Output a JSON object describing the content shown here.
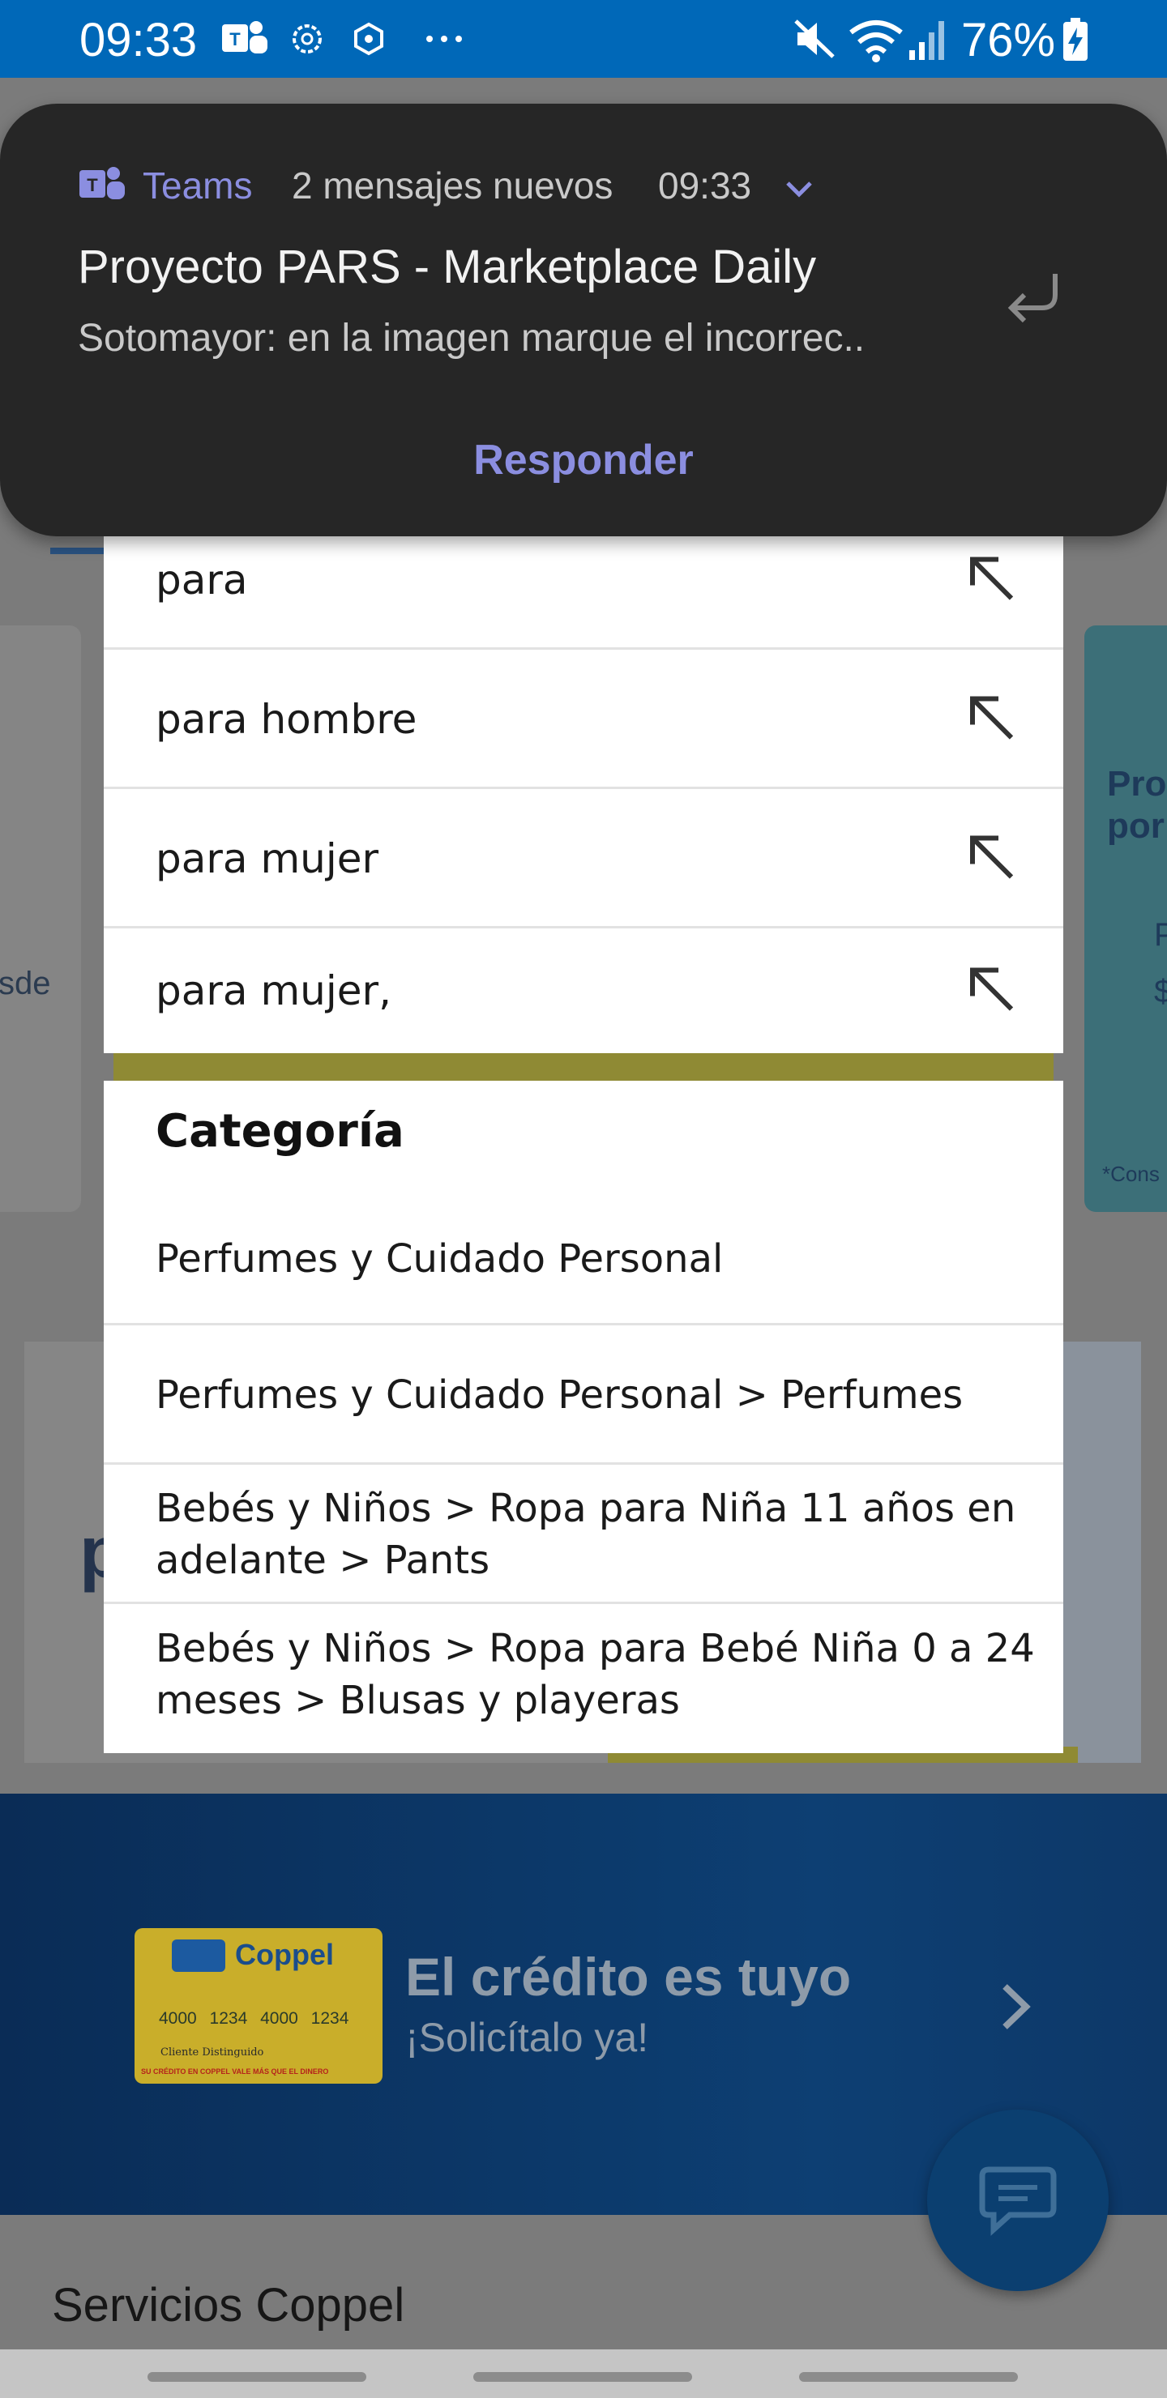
{
  "status_bar": {
    "time": "09:33",
    "battery": "76%",
    "icons": [
      "teams-icon",
      "settings-gear-icon",
      "assistant-icon",
      "more-dots-icon",
      "mute-icon",
      "wifi-icon",
      "signal-icon",
      "battery-charging-icon"
    ]
  },
  "notification": {
    "app": "Teams",
    "summary": "2 mensajes nuevos",
    "time": "09:33",
    "title": "Proyecto PARS - Marketplace Daily",
    "text": "Sotomayor: en la imagen marque el incorrec..",
    "reply_label": "Responder",
    "accent_color": "#8b8ee0"
  },
  "suggestions": [
    {
      "label": "para"
    },
    {
      "label": "para hombre"
    },
    {
      "label": "para mujer"
    },
    {
      "label": "para mujer,"
    }
  ],
  "category": {
    "title": "Categoría",
    "items": [
      {
        "label": "Perfumes y Cuidado Personal"
      },
      {
        "label": "Perfumes y Cuidado Personal > Perfumes"
      },
      {
        "label": "Bebés y Niños > Ropa para Niña 11 años en adelante > Pants"
      },
      {
        "label": "Bebés y Niños > Ropa para Bebé Niña 0 a 24 meses > Blusas y playeras"
      }
    ]
  },
  "background": {
    "left_card_text": "sde",
    "right_card_promo": "Pro\npor",
    "right_card_p": "P",
    "right_card_s": "$",
    "right_card_cons": "*Cons",
    "mid_banner_letter": "p",
    "credit_banner": {
      "card_brand": "Coppel",
      "card_number": "4000 1234 4000 1234",
      "card_holder": "Cliente Distinguido",
      "card_footer": "SU CRÉDITO EN COPPEL VALE MÁS QUE EL DINERO",
      "title": "El crédito es tuyo",
      "subtitle": "¡Solicítalo ya!"
    },
    "section_title": "Servicios Coppel"
  },
  "colors": {
    "status_bar": "#0068b8",
    "notification_bg": "#262626",
    "brand_blue": "#0d3f73"
  }
}
